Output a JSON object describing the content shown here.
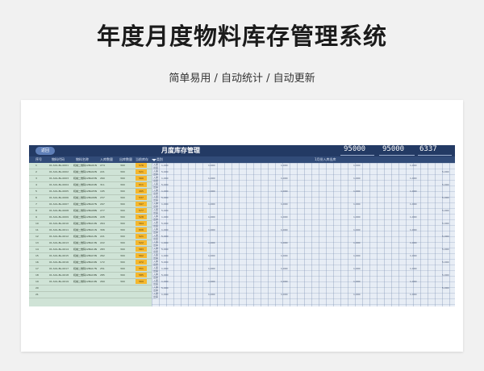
{
  "page": {
    "title": "年度月度物料库存管理系统",
    "subtitle": "简单易用 / 自动统计 / 自动更新"
  },
  "sheet": {
    "title": "月度库存管理",
    "pill_label": "返回",
    "metrics": [
      "95000",
      "95000",
      "6337"
    ],
    "header": {
      "col_num": "序号",
      "col_id": "物料代码",
      "col_name": "物料名称",
      "col_in": "入库数量",
      "col_out": "出库数量",
      "col_stock": "当前库存",
      "col_type": "类别",
      "month_group": "1月份入库出库"
    },
    "rows": [
      {
        "num": "1",
        "id": "01-SUL-BL-0001",
        "name": "机械二维码12BA01N",
        "in": "274",
        "out": "300",
        "stock": "576"
      },
      {
        "num": "2",
        "id": "01-SUL-BL-0002",
        "name": "机械二维码12BA02N",
        "in": "221",
        "out": "300",
        "stock": "521"
      },
      {
        "num": "3",
        "id": "01-SUL-BL-0003",
        "name": "机械二维码12BA03N",
        "in": "260",
        "out": "300",
        "stock": "560"
      },
      {
        "num": "4",
        "id": "01-SUL-BL-0004",
        "name": "机械二维码12BA04N",
        "in": "311",
        "out": "300",
        "stock": "611"
      },
      {
        "num": "5",
        "id": "01-SUL-BL-0005",
        "name": "机械二维码12BA05N",
        "in": "195",
        "out": "300",
        "stock": "495"
      },
      {
        "num": "6",
        "id": "01-SUL-BL-0006",
        "name": "机械二维码12BA06N",
        "in": "237",
        "out": "300",
        "stock": "537"
      },
      {
        "num": "7",
        "id": "01-SUL-BL-0007",
        "name": "机械二维码12BA07N",
        "in": "297",
        "out": "300",
        "stock": "597"
      },
      {
        "num": "8",
        "id": "01-SUL-BL-0008",
        "name": "机械二维码12BA08N",
        "in": "277",
        "out": "300",
        "stock": "577"
      },
      {
        "num": "9",
        "id": "01-SUL-BL-0009",
        "name": "机械二维码12BA09N",
        "in": "228",
        "out": "300",
        "stock": "528"
      },
      {
        "num": "10",
        "id": "01-SUL-BL-0010",
        "name": "机械二维码12BA10N",
        "in": "264",
        "out": "300",
        "stock": "564"
      },
      {
        "num": "11",
        "id": "01-SUL-BL-0011",
        "name": "机械二维码12BA11N",
        "in": "306",
        "out": "300",
        "stock": "606"
      },
      {
        "num": "12",
        "id": "01-SUL-BL-0012",
        "name": "机械二维码12BA12N",
        "in": "221",
        "out": "300",
        "stock": "521"
      },
      {
        "num": "13",
        "id": "01-SUL-BL-0013",
        "name": "机械二维码12BA13N",
        "in": "222",
        "out": "300",
        "stock": "522"
      },
      {
        "num": "14",
        "id": "01-SUL-BL-0014",
        "name": "机械二维码12BA14N",
        "in": "283",
        "out": "300",
        "stock": "583"
      },
      {
        "num": "15",
        "id": "01-SUL-BL-0015",
        "name": "机械二维码12BA15N",
        "in": "262",
        "out": "300",
        "stock": "562"
      },
      {
        "num": "16",
        "id": "01-SUL-BL-0016",
        "name": "机械二维码12BA16N",
        "in": "172",
        "out": "300",
        "stock": "472"
      },
      {
        "num": "17",
        "id": "01-SUL-BL-0017",
        "name": "机械二维码12BA17N",
        "in": "251",
        "out": "300",
        "stock": "551"
      },
      {
        "num": "18",
        "id": "01-SUL-BL-0018",
        "name": "机械二维码12BA18N",
        "in": "285",
        "out": "300",
        "stock": "585"
      },
      {
        "num": "19",
        "id": "01-SUL-BL-0019",
        "name": "机械二维码12BA19N",
        "in": "269",
        "out": "300",
        "stock": "569"
      },
      {
        "num": "20",
        "id": "",
        "name": "",
        "in": "",
        "out": "",
        "stock": ""
      },
      {
        "num": "21",
        "id": "",
        "name": "",
        "in": "",
        "out": "",
        "stock": ""
      }
    ],
    "type_labels": [
      "入库",
      "出库"
    ],
    "value_labels": [
      "1,000",
      "5,000"
    ]
  },
  "colors": {
    "nav": "#233a64",
    "badge": "#f5b82e",
    "leftcol": "#cfe3d6"
  }
}
